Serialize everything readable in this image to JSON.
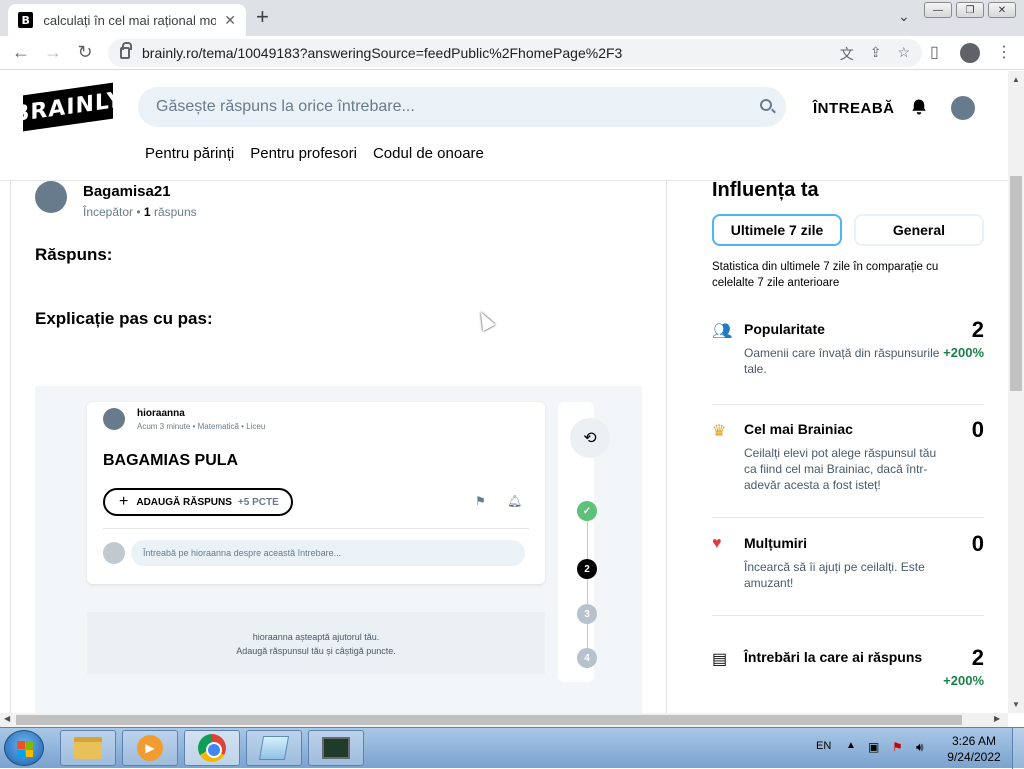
{
  "browser": {
    "tab_title": "calculați în cel mai rațional mod posibil",
    "tab_favicon": "B",
    "url": "brainly.ro/tema/10049183?answeringSource=feedPublic%2FhomePage%2F3"
  },
  "header": {
    "logo": "BRAINLY",
    "search_placeholder": "Găsește răspuns la orice întrebare...",
    "ask_label": "ÎNTREABĂ",
    "nav": [
      "Pentru părinți",
      "Pentru profesori",
      "Codul de onoare"
    ]
  },
  "answer": {
    "username": "Bagamisa21",
    "rank": "Începător",
    "count_num": "1",
    "count_label": "răspuns",
    "heading1": "Răspuns:",
    "heading2": "Explicație pas cu pas:"
  },
  "embedded": {
    "user": "hioraanna",
    "meta": "Acum 3 minute • Matematică • Liceu",
    "title": "BAGAMIAS PULA",
    "add_label": "ADAUGĂ RĂSPUNS",
    "add_points": "+5 PCTE",
    "input_placeholder": "Întreabă pe hioraanna despre această întrebare...",
    "wait_line1": "hioraanna așteaptă ajutorul tău.",
    "wait_line2": "Adaugă răspunsul tău și câștigă puncte.",
    "steps": [
      "✓",
      "2",
      "3",
      "4"
    ]
  },
  "influence": {
    "title": "Influența ta",
    "tab_active": "Ultimele 7 zile",
    "tab_inactive": "General",
    "description": "Statistica din ultimele 7 zile în comparație cu celelalte 7 zile anterioare",
    "stats": [
      {
        "name": "Popularitate",
        "desc": "Oamenii care învață din răspunsurile tale.",
        "value": "2",
        "delta": "+200%",
        "icon": "people-icon"
      },
      {
        "name": "Cel mai Brainiac",
        "desc": "Ceilalți elevi pot alege răspunsul tău ca fiind cel mai Brainiac, dacă într-adevăr acesta a fost isteț!",
        "value": "0",
        "delta": "",
        "icon": "crown-icon"
      },
      {
        "name": "Mulțumiri",
        "desc": "Încearcă să îi ajuți pe ceilalți. Este amuzant!",
        "value": "0",
        "delta": "",
        "icon": "heart-icon"
      },
      {
        "name": "Întrebări la care ai răspuns",
        "desc": "",
        "value": "2",
        "delta": "+200%",
        "icon": "questions-icon"
      }
    ]
  },
  "taskbar": {
    "lang": "EN",
    "time": "3:26 AM",
    "date": "9/24/2022"
  },
  "colors": {
    "accent_blue": "#4fb3f6",
    "positive_green": "#1a8049",
    "crown": "#e8a317",
    "heart": "#e03c3c",
    "people": "#1f7ac4"
  }
}
